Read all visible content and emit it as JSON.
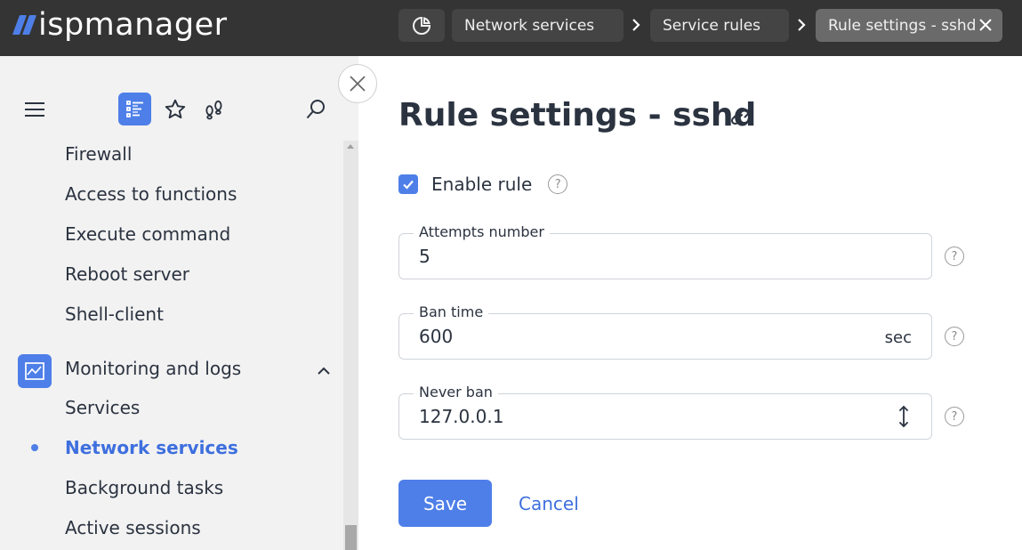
{
  "app": {
    "logo_text": "ispmanager"
  },
  "breadcrumbs": {
    "home_icon": "dashboard-pie-icon",
    "items": [
      {
        "label": "Network services"
      },
      {
        "label": "Service rules"
      },
      {
        "label": "Rule settings - sshd"
      }
    ]
  },
  "sidebar": {
    "toolbar": {
      "menu_icon": "hamburger-icon",
      "list_icon": "menu-list-icon",
      "star_icon": "star-icon",
      "recent_icon": "footprints-icon",
      "search_icon": "search-icon"
    },
    "items_before": [
      {
        "label": "Firewall"
      },
      {
        "label": "Access to functions"
      },
      {
        "label": "Execute command"
      },
      {
        "label": "Reboot server"
      },
      {
        "label": "Shell-client"
      }
    ],
    "group": {
      "label": "Monitoring and logs",
      "icon": "chart-line-icon",
      "expanded": true
    },
    "items_after": [
      {
        "label": "Services",
        "active": false
      },
      {
        "label": "Network services",
        "active": true
      },
      {
        "label": "Background tasks",
        "active": false
      },
      {
        "label": "Active sessions",
        "active": false
      }
    ]
  },
  "form": {
    "title": "Rule settings - sshd",
    "enable_rule": {
      "label": "Enable rule",
      "checked": true
    },
    "attempts": {
      "label": "Attempts number",
      "value": "5"
    },
    "ban_time": {
      "label": "Ban time",
      "value": "600",
      "suffix": "sec"
    },
    "never_ban": {
      "label": "Never ban",
      "value": "127.0.0.1"
    },
    "help_glyph": "?",
    "save_label": "Save",
    "cancel_label": "Cancel"
  },
  "colors": {
    "accent": "#4e7fe8",
    "topbar": "#343434",
    "sidebar_bg": "#f2f2f2",
    "text": "#2b3340"
  }
}
